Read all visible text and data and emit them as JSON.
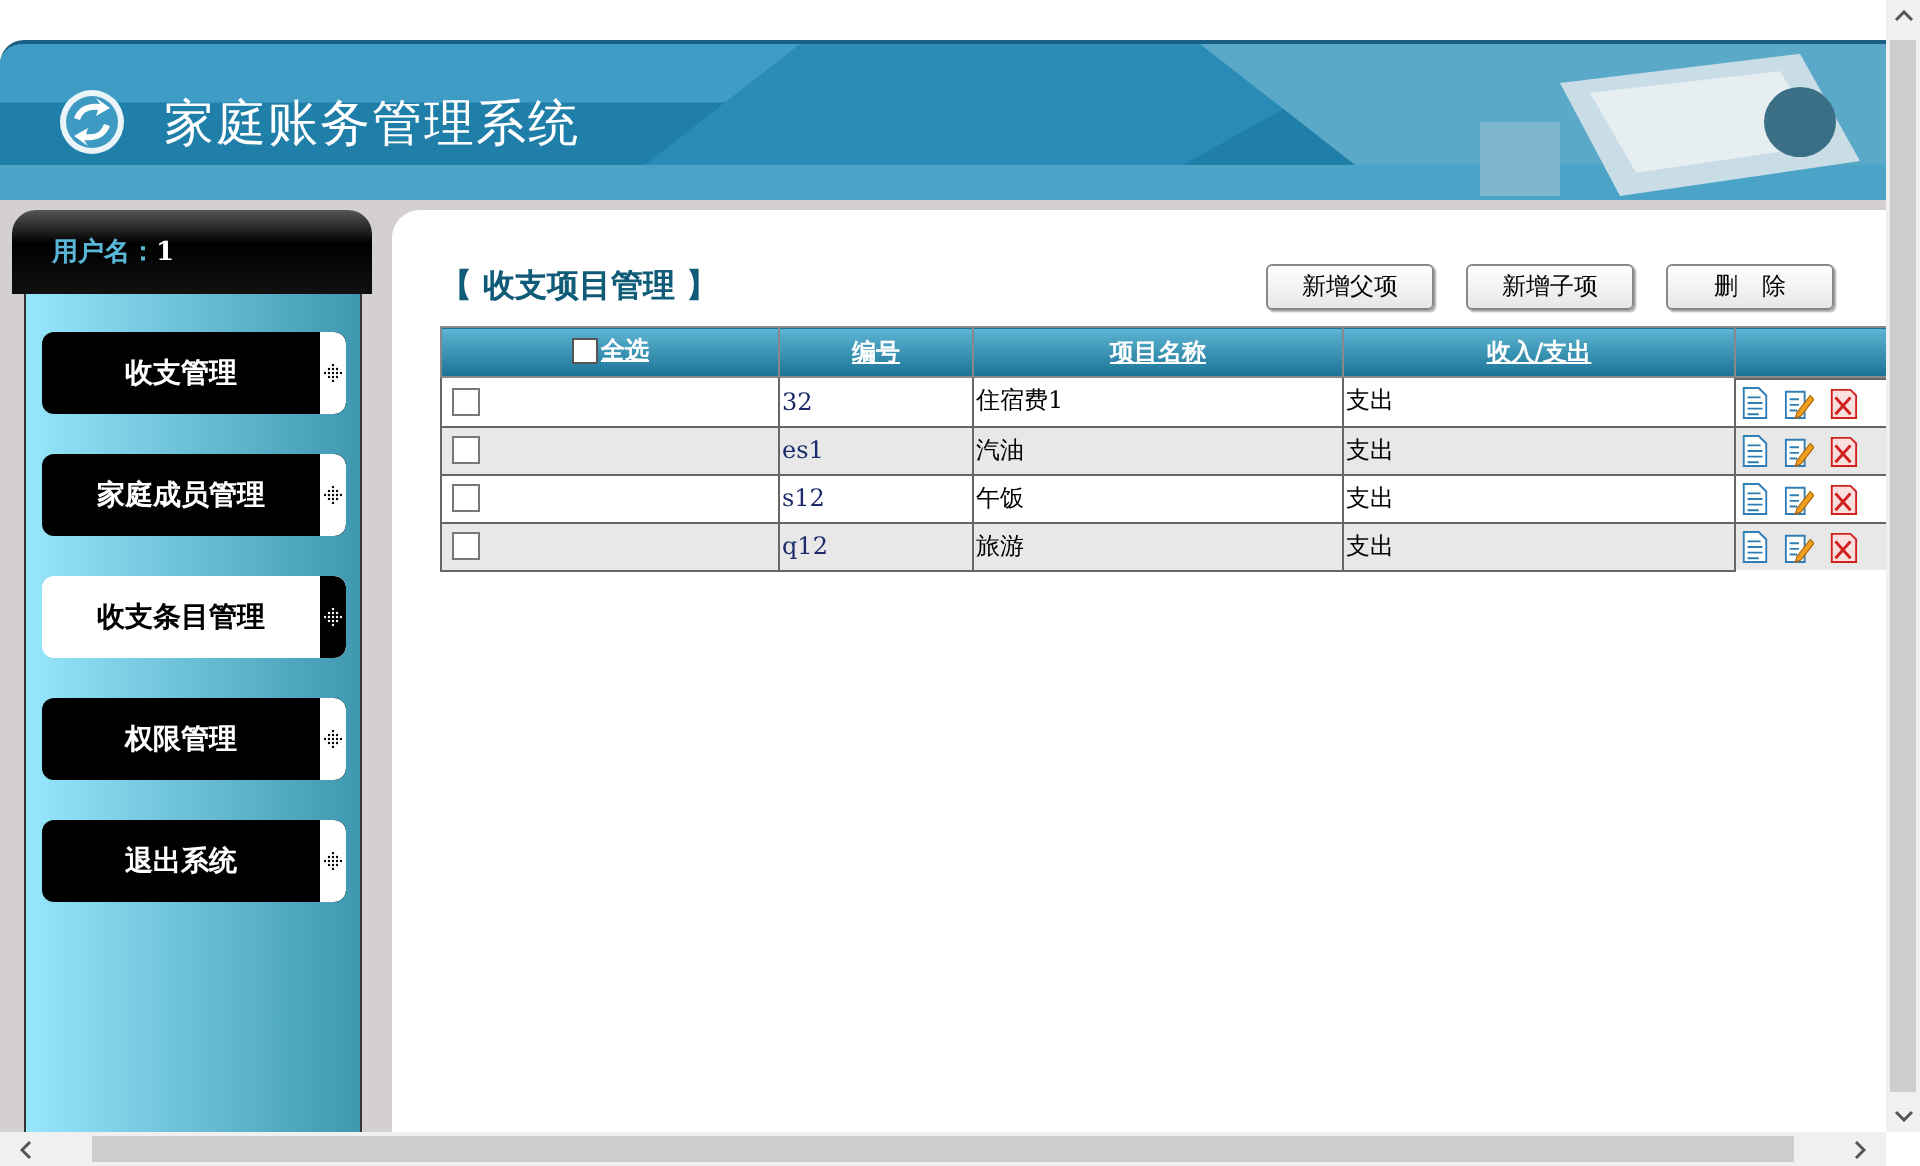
{
  "header": {
    "title": "家庭账务管理系统"
  },
  "sidebar": {
    "user_label": "用户名：",
    "user_value": "1",
    "items": [
      {
        "label": "收支管理",
        "selected": false
      },
      {
        "label": "家庭成员管理",
        "selected": false
      },
      {
        "label": "收支条目管理",
        "selected": true
      },
      {
        "label": "权限管理",
        "selected": false
      },
      {
        "label": "退出系统",
        "selected": false
      }
    ]
  },
  "page_title": "【 收支项目管理 】",
  "buttons": [
    "新增父项",
    "新增子项",
    "删　除"
  ],
  "table": {
    "select_all": {
      "label": "全选",
      "checked": false
    },
    "columns": [
      "编号",
      "项目名称",
      "收入/支出"
    ],
    "rows": [
      {
        "checked": false,
        "cells": [
          "32",
          "住宿费1",
          "支出"
        ]
      },
      {
        "checked": false,
        "cells": [
          "es1",
          "汽油",
          "支出"
        ]
      },
      {
        "checked": false,
        "cells": [
          "s12",
          "午饭",
          "支出"
        ]
      },
      {
        "checked": false,
        "cells": [
          "q12",
          "旅游",
          "支出"
        ]
      }
    ]
  }
}
